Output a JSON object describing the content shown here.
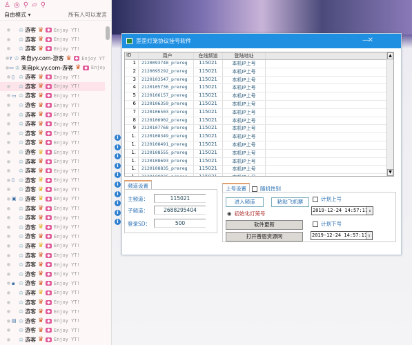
{
  "left_panel": {
    "icons": [
      "user-icon",
      "chat-icon",
      "location-icon",
      "share-icon",
      "search-icon"
    ],
    "mode_label": "自由模式",
    "permission_label": "所有人可以发言",
    "rows": [
      {
        "name": "游客",
        "crown": "red",
        "badge": "",
        "enjoy": "Enjoy YT!"
      },
      {
        "name": "游客",
        "crown": "red",
        "badge": "",
        "enjoy": "Enjoy YT!"
      },
      {
        "name": "游客",
        "crown": "red",
        "badge": "",
        "enjoy": "Enjoy YT!"
      },
      {
        "name": "来自yy.com-游客",
        "crown": "red",
        "badge": "Y",
        "enjoy": "Enjoy YT"
      },
      {
        "name": "来自pk.yy.com-游客",
        "crown": "red",
        "badge": "▭",
        "enjoy": "Enjoy"
      },
      {
        "name": "游客",
        "crown": "red",
        "badge": "▯",
        "enjoy": "Enjoy YT!"
      },
      {
        "name": "游客",
        "crown": "red",
        "badge": "",
        "enjoy": "Enjoy YT!",
        "highlight": true
      },
      {
        "name": "游客",
        "crown": "red",
        "badge": "▭",
        "enjoy": "Enjoy YT!"
      },
      {
        "name": "游客",
        "crown": "red",
        "badge": "",
        "enjoy": "Enjoy YT!"
      },
      {
        "name": "游客",
        "crown": "red",
        "badge": "",
        "enjoy": "Enjoy YT!"
      },
      {
        "name": "游客",
        "crown": "red",
        "badge": "",
        "enjoy": "Enjoy YT!"
      },
      {
        "name": "游客",
        "crown": "red",
        "badge": "",
        "enjoy": "Enjoy YT!"
      },
      {
        "name": "游客",
        "crown": "red",
        "badge": "",
        "enjoy": "Enjoy YT!"
      },
      {
        "name": "游客",
        "crown": "gold",
        "badge": "",
        "enjoy": "Enjoy YT!"
      },
      {
        "name": "游客",
        "crown": "red",
        "badge": "",
        "enjoy": "Enjoy YT!"
      },
      {
        "name": "游客",
        "crown": "red",
        "badge": "",
        "enjoy": "Enjoy YT!"
      },
      {
        "name": "游客",
        "crown": "gold",
        "badge": "▯",
        "enjoy": "Enjoy YT!"
      },
      {
        "name": "游客",
        "crown": "gold",
        "badge": "",
        "enjoy": "Enjoy YT!"
      },
      {
        "name": "游客",
        "crown": "gold",
        "badge": "▣",
        "enjoy": "Enjoy YT!"
      },
      {
        "name": "游客",
        "crown": "red",
        "badge": "",
        "enjoy": "Enjoy YT!"
      },
      {
        "name": "游客",
        "crown": "red",
        "badge": "",
        "enjoy": "Enjoy YT!"
      },
      {
        "name": "游客",
        "crown": "gold",
        "badge": "",
        "enjoy": "Enjoy YT!"
      },
      {
        "name": "游客",
        "crown": "red",
        "badge": "",
        "enjoy": "Enjoy YT!"
      },
      {
        "name": "游客",
        "crown": "gold",
        "badge": "",
        "enjoy": "Enjoy YT!"
      },
      {
        "name": "游客",
        "crown": "red",
        "badge": "",
        "enjoy": "Enjoy YT!"
      },
      {
        "name": "游客",
        "crown": "red",
        "badge": "",
        "enjoy": "Enjoy YT!"
      },
      {
        "name": "游客",
        "crown": "red",
        "badge": "",
        "enjoy": "Enjoy YT!"
      },
      {
        "name": "游客",
        "crown": "red",
        "badge": "▪",
        "enjoy": "Enjoy YT!"
      },
      {
        "name": "游客",
        "crown": "gold",
        "badge": "",
        "enjoy": "Enjoy YT!"
      },
      {
        "name": "游客",
        "crown": "red",
        "badge": "",
        "enjoy": "Enjoy YT!"
      },
      {
        "name": "游客",
        "crown": "red",
        "badge": "",
        "enjoy": "Enjoy YT!"
      },
      {
        "name": "游客",
        "crown": "red",
        "badge": "▤",
        "enjoy": "Enjoy YT!"
      },
      {
        "name": "游客",
        "crown": "red",
        "badge": "",
        "enjoy": "Enjoy YT!"
      },
      {
        "name": "游客",
        "crown": "red",
        "badge": "",
        "enjoy": "Enjoy YT!"
      }
    ]
  },
  "window": {
    "title": "歪歪灯笼协议挂号软件",
    "min_icon": "minimize-icon",
    "close_icon": "close-icon",
    "table": {
      "columns": [
        "ID",
        "用户",
        "在线频道",
        "登陆地址"
      ],
      "rows": [
        [
          "1",
          "2120093748_prereg",
          "115021",
          "本机IP上号"
        ],
        [
          "2",
          "2120095292_prereg",
          "115021",
          "本机IP上号"
        ],
        [
          "3",
          "2120103547_prereg",
          "115021",
          "本机IP上号"
        ],
        [
          "4",
          "2120105736_prereg",
          "115021",
          "本机IP上号"
        ],
        [
          "5",
          "2120106157_prereg",
          "115021",
          "本机IP上号"
        ],
        [
          "6",
          "2120106359_prereg",
          "115021",
          "本机IP上号"
        ],
        [
          "7",
          "2120106503_prereg",
          "115021",
          "本机IP上号"
        ],
        [
          "8",
          "2120106902_prereg",
          "115021",
          "本机IP上号"
        ],
        [
          "9",
          "2120107768_prereg",
          "115021",
          "本机IP上号"
        ],
        [
          "1.",
          "2120108349_prereg",
          "115021",
          "本机IP上号"
        ],
        [
          "1.",
          "2120108491_prereg",
          "115021",
          "本机IP上号"
        ],
        [
          "1.",
          "2120108555_prereg",
          "115021",
          "本机IP上号"
        ],
        [
          "1.",
          "2120108693_prereg",
          "115021",
          "本机IP上号"
        ],
        [
          "1.",
          "2120108835_prereg",
          "115021",
          "本机IP上号"
        ],
        [
          "1.",
          "2120108936_prereg",
          "115021",
          "本机IP上号"
        ]
      ]
    },
    "channel": {
      "tab": "频道设置",
      "main_label": "主频道：",
      "main_value": "115021",
      "sub_label": "子频道：",
      "sub_value": "2688295404",
      "sd_label": "登录SD：",
      "sd_value": "500"
    },
    "login": {
      "tab": "上号设置",
      "random_gender": "随机性别",
      "enter_channel": "进入频道",
      "paste_ticket": "粘贴飞机票",
      "init_radio": "初始化灯笼号",
      "update": "软件更新",
      "open_site": "打开善恩资源网",
      "plan_login": "计划上号",
      "plan_login_time": "2019-12-24 14:57:11",
      "plan_logout": "计划下号",
      "plan_logout_time": "2019-12-24 14:57:11"
    }
  }
}
